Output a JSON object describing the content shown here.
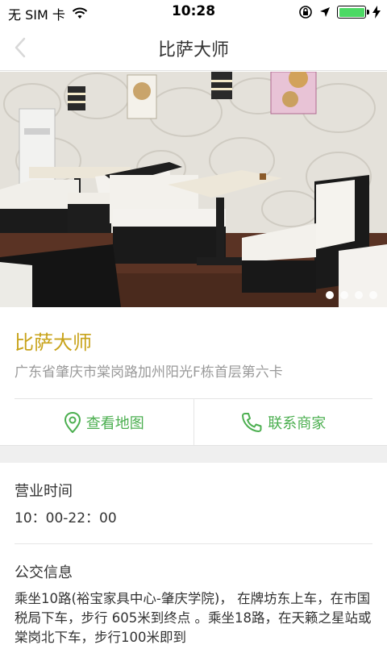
{
  "status_bar": {
    "carrier": "无 SIM 卡",
    "time": "10:28",
    "battery_level": 1.0
  },
  "nav": {
    "title": "比萨大师",
    "back_icon": "chevron-left-icon"
  },
  "gallery": {
    "image_count": 4,
    "active_index": 0
  },
  "store": {
    "name": "比萨大师",
    "address": "广东省肇庆市棠岗路加州阳光F栋首层第六卡"
  },
  "actions": {
    "map_label": "查看地图",
    "map_icon": "location-pin-icon",
    "contact_label": "联系商家",
    "contact_icon": "phone-icon"
  },
  "hours": {
    "title": "营业时间",
    "value": "10：00-22：00"
  },
  "bus": {
    "title": "公交信息",
    "text": "乘坐10路(裕宝家具中心-肇庆学院)， 在牌坊东上车，在市国税局下车，步行 605米到终点 。乘坐18路，在天籁之星站或棠岗北下车，步行100米即到"
  },
  "colors": {
    "accent_gold": "#c8a31a",
    "action_green": "#4caf50",
    "battery_green": "#4cd964"
  }
}
